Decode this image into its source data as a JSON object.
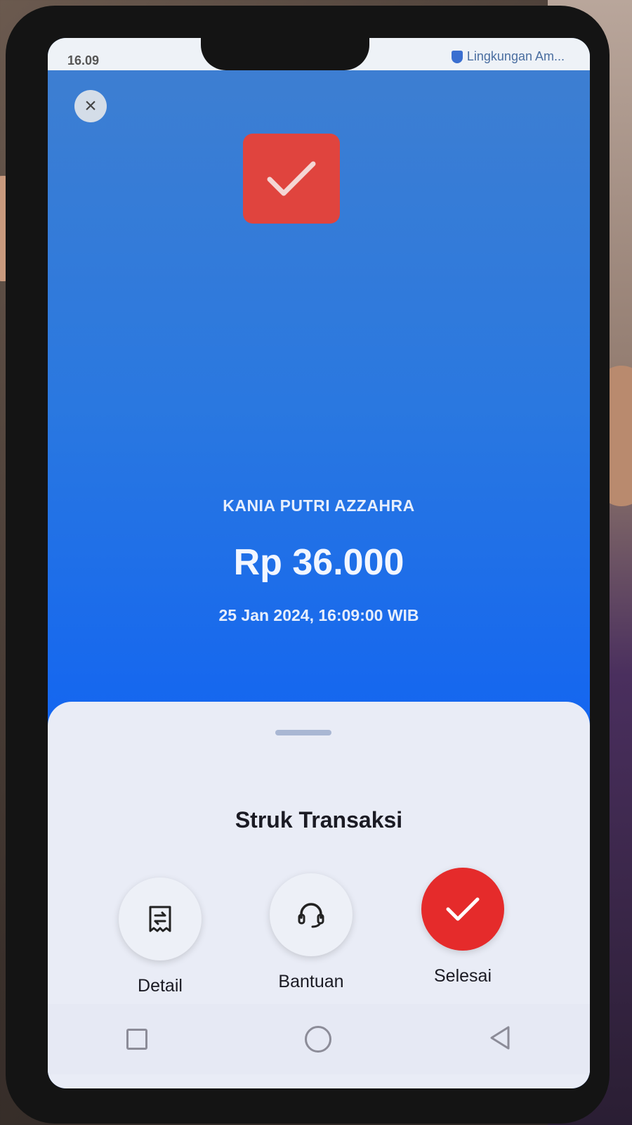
{
  "status_bar": {
    "time": "16.09",
    "signal_icon": "signal-icon",
    "environment_label": "Lingkungan Am..."
  },
  "header": {
    "close_icon": "close-icon",
    "success_icon": "checkmark-icon"
  },
  "transaction": {
    "recipient_name": "KANIA PUTRI AZZAHRA",
    "amount": "Rp 36.000",
    "datetime": "25 Jan 2024, 16:09:00 WIB"
  },
  "sheet": {
    "title": "Struk Transaksi",
    "actions": [
      {
        "label": "Detail",
        "icon": "receipt-transfer-icon"
      },
      {
        "label": "Bantuan",
        "icon": "headset-icon"
      },
      {
        "label": "Selesai",
        "icon": "checkmark-icon"
      }
    ]
  },
  "navigation": {
    "icons": [
      "recent-apps-icon",
      "home-icon",
      "back-icon"
    ]
  },
  "colors": {
    "primary_blue": "#1466f0",
    "success_red": "#e0443e",
    "done_button": "#e52b2b",
    "sheet_background": "#e9ecf6"
  }
}
